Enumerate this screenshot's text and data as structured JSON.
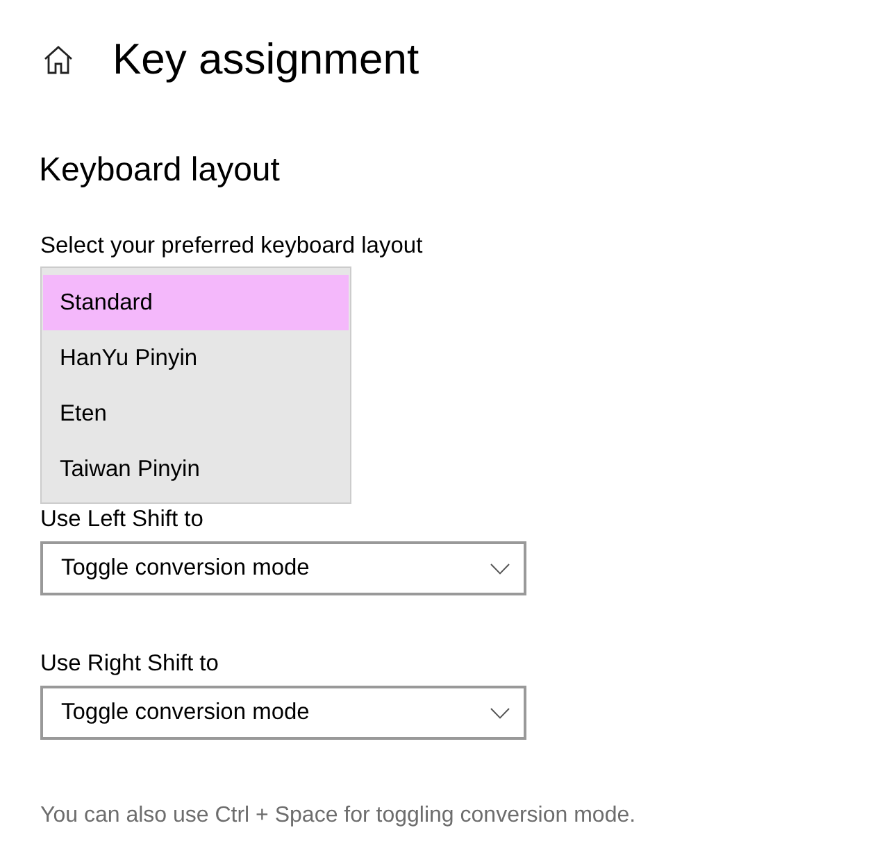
{
  "header": {
    "title": "Key assignment"
  },
  "section": {
    "heading": "Keyboard layout"
  },
  "layout_select": {
    "label": "Select your preferred keyboard layout",
    "options": [
      {
        "label": "Standard",
        "selected": true
      },
      {
        "label": "HanYu Pinyin",
        "selected": false
      },
      {
        "label": "Eten",
        "selected": false
      },
      {
        "label": "Taiwan Pinyin",
        "selected": false
      }
    ]
  },
  "shift_settings": [
    {
      "label": "Use Left Shift to",
      "value": "Toggle conversion mode"
    },
    {
      "label": "Use Right Shift to",
      "value": "Toggle conversion mode"
    }
  ],
  "note": "You can also use Ctrl + Space for toggling conversion mode."
}
